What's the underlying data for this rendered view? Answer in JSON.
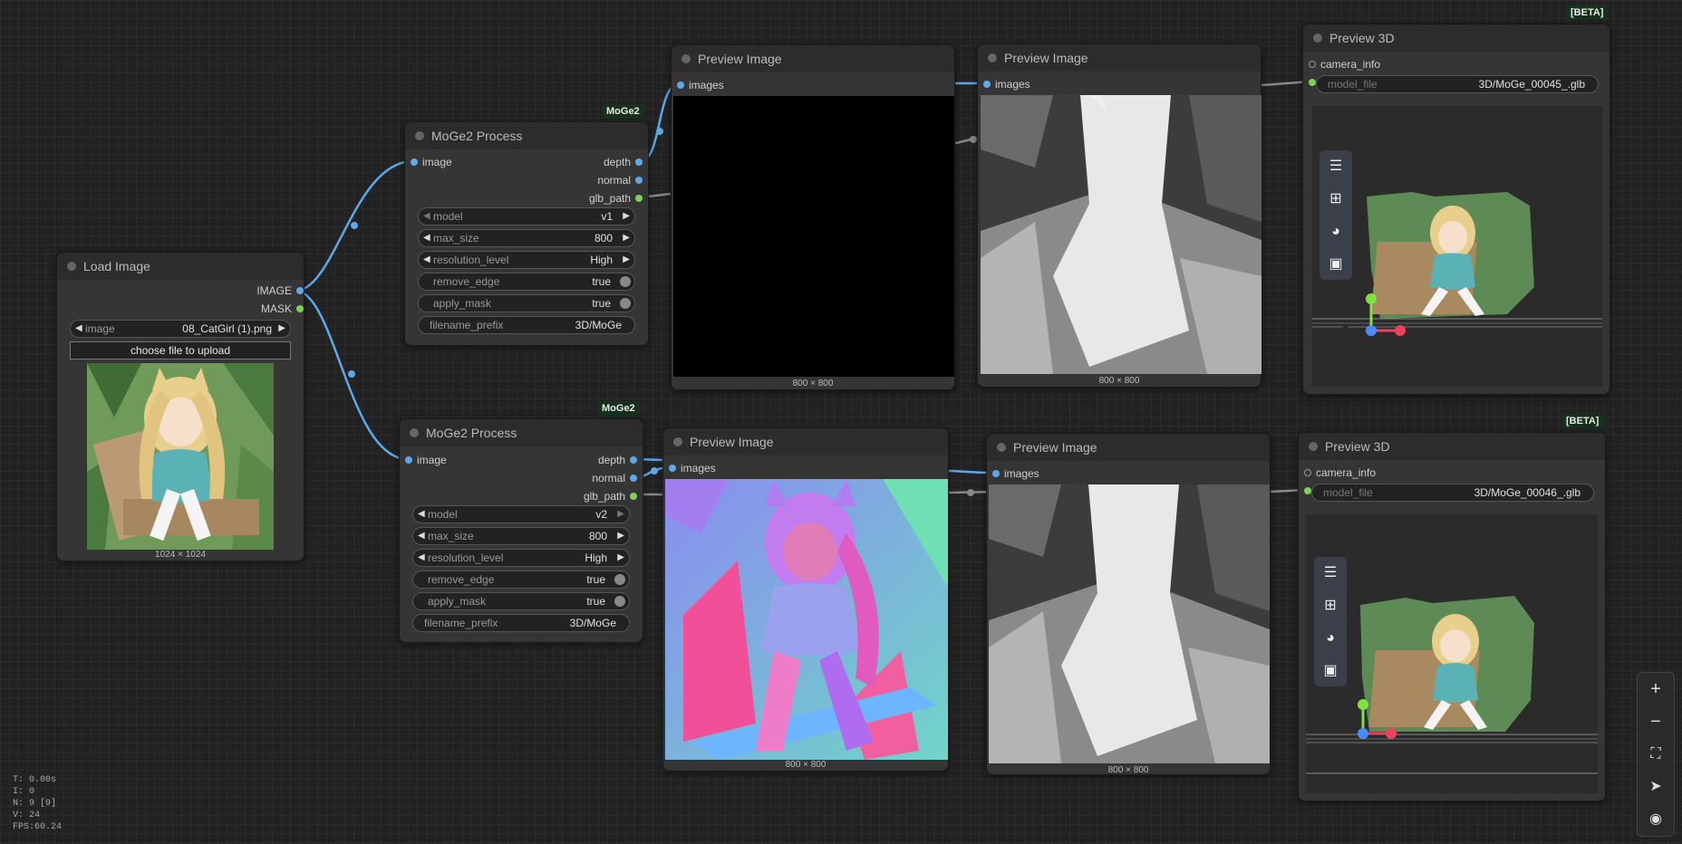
{
  "load_image": {
    "title": "Load Image",
    "outputs": [
      "IMAGE",
      "MASK"
    ],
    "widget_label": "image",
    "widget_value": "08_CatGirl (1).png",
    "upload_label": "choose file to upload",
    "dimensions": "1024 × 1024"
  },
  "moge_top": {
    "badge": "MoGe2",
    "title": "MoGe2 Process",
    "input": "image",
    "outputs": [
      "depth",
      "normal",
      "glb_path"
    ],
    "model_label": "model",
    "model_value": "v1",
    "max_size_label": "max_size",
    "max_size_value": "800",
    "resolution_label": "resolution_level",
    "resolution_value": "High",
    "remove_edge_label": "remove_edge",
    "remove_edge_value": "true",
    "apply_mask_label": "apply_mask",
    "apply_mask_value": "true",
    "prefix_label": "filename_prefix",
    "prefix_value": "3D/MoGe"
  },
  "moge_bottom": {
    "badge": "MoGe2",
    "title": "MoGe2 Process",
    "input": "image",
    "outputs": [
      "depth",
      "normal",
      "glb_path"
    ],
    "model_label": "model",
    "model_value": "v2",
    "max_size_label": "max_size",
    "max_size_value": "800",
    "resolution_label": "resolution_level",
    "resolution_value": "High",
    "remove_edge_label": "remove_edge",
    "remove_edge_value": "true",
    "apply_mask_label": "apply_mask",
    "apply_mask_value": "true",
    "prefix_label": "filename_prefix",
    "prefix_value": "3D/MoGe"
  },
  "preview_top_a": {
    "title": "Preview Image",
    "input": "images",
    "dimensions": "800 × 800"
  },
  "preview_top_b": {
    "title": "Preview Image",
    "input": "images",
    "dimensions": "800 × 800"
  },
  "preview_bottom_a": {
    "title": "Preview Image",
    "input": "images",
    "dimensions": "800 × 800"
  },
  "preview_bottom_b": {
    "title": "Preview Image",
    "input": "images",
    "dimensions": "800 × 800"
  },
  "preview3d_top": {
    "badge": "[BETA]",
    "title": "Preview 3D",
    "input": "camera_info",
    "model_file_label": "model_file",
    "model_file_value": "3D/MoGe_00045_.glb"
  },
  "preview3d_bottom": {
    "badge": "[BETA]",
    "title": "Preview 3D",
    "input": "camera_info",
    "model_file_label": "model_file",
    "model_file_value": "3D/MoGe_00046_.glb"
  },
  "viewer_toolbar_icons": [
    "menu-icon",
    "grid-icon",
    "palette-icon",
    "image-icon"
  ],
  "canvas_controls_icons": [
    "zoom-in-icon",
    "zoom-out-icon",
    "fit-view-icon",
    "navigate-icon",
    "visibility-icon"
  ],
  "stats": {
    "t": "T: 0.00s",
    "i": "I: 0",
    "n": "N: 9 [9]",
    "v": "V: 24",
    "fps": "FPS:60.24"
  },
  "colors": {
    "link_image": "#5fa8e8",
    "link_glb": "#7fd15a",
    "node_bg": "#353535",
    "canvas_bg": "#222222"
  }
}
